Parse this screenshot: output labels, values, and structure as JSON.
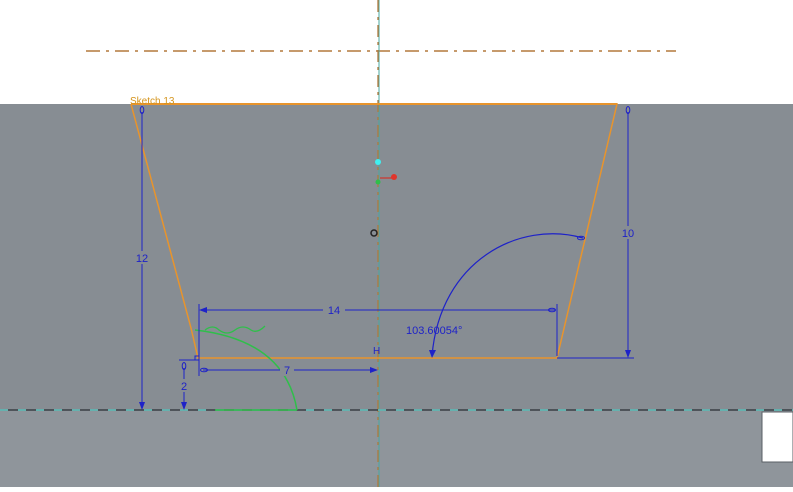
{
  "sketch": {
    "name": "Sketch 13",
    "constraint_label": "H"
  },
  "dimensions": {
    "top_to_bottom_height": "12",
    "right_height": "10",
    "bottom_width": "14",
    "half_width": "7",
    "base_offset": "2",
    "angle": "103.60054°"
  },
  "colors": {
    "canvas_light": "#ffffff",
    "part_face": "#878d93",
    "part_face_lower": "#8f959b",
    "sketch_line": "#e8942c",
    "dimension": "#1e22c8",
    "centerline": "#b4783c",
    "axis_teal": "#4aa8a0",
    "selected_green": "#2fbf4a"
  }
}
